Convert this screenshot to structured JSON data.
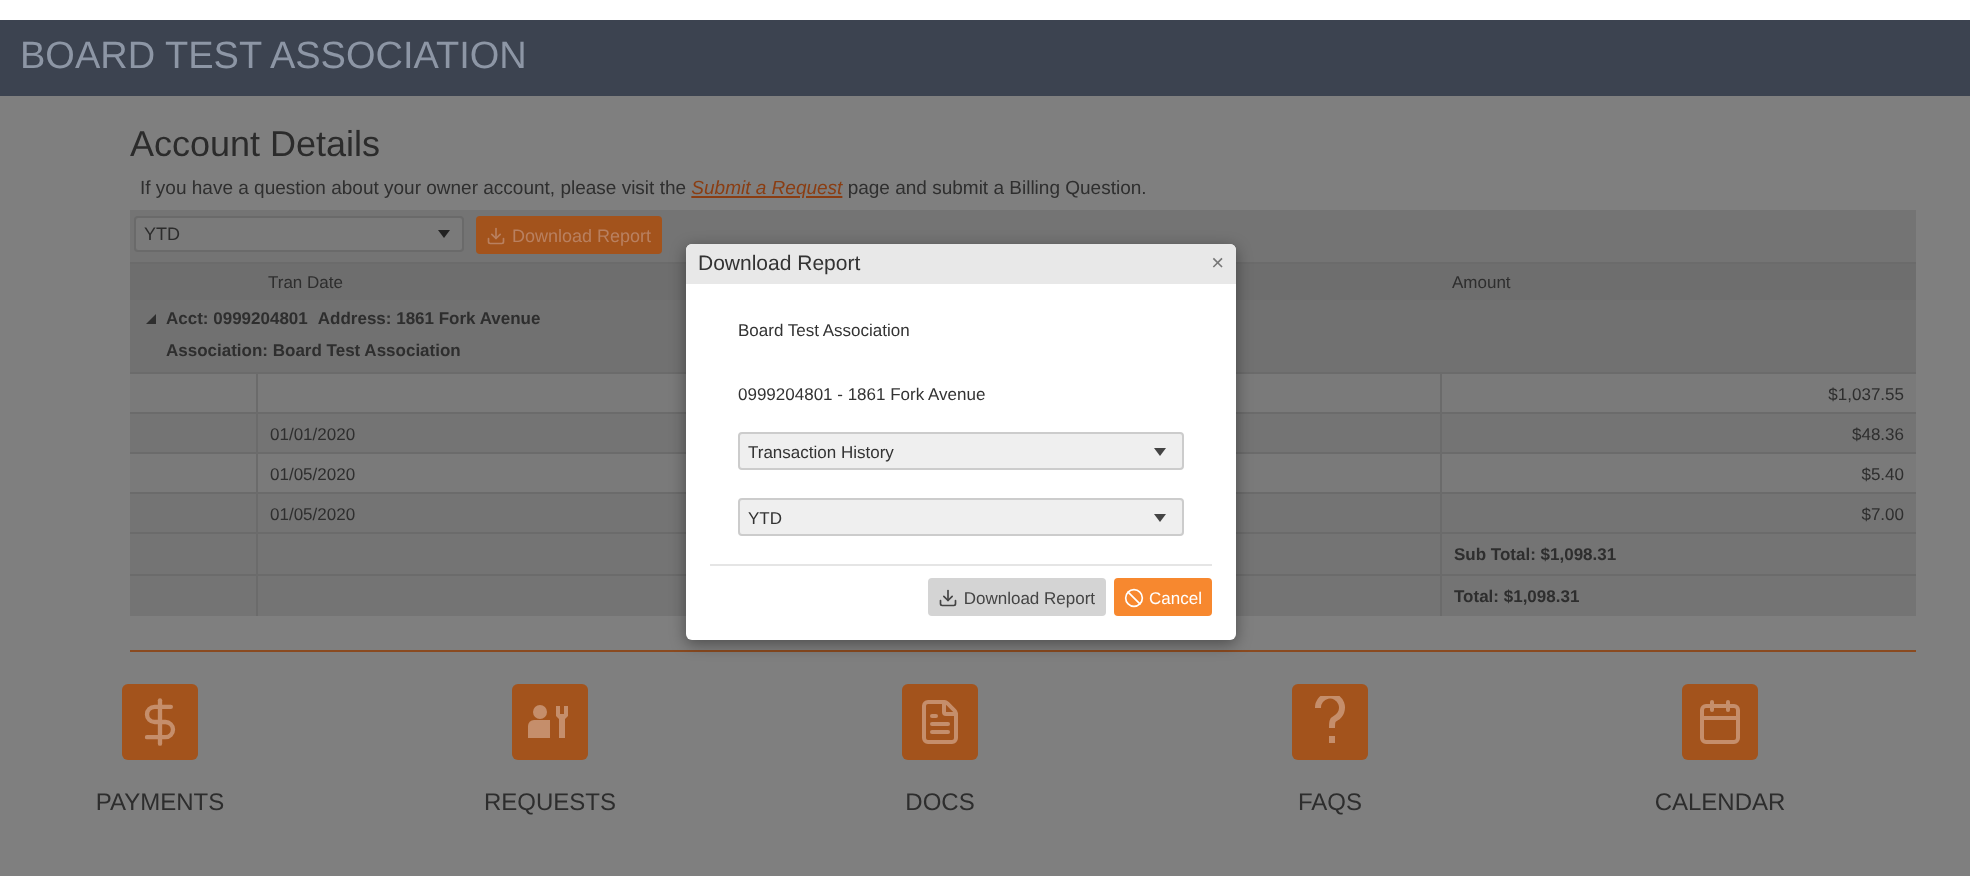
{
  "header": {
    "title": "BOARD TEST ASSOCIATION"
  },
  "page": {
    "title": "Account Details",
    "intro_before": "If you have a question about your owner account, please visit the ",
    "intro_link": "Submit a Request",
    "intro_after": " page and submit a Billing Question."
  },
  "toolbar": {
    "period": "YTD",
    "download_button": "Download Report"
  },
  "table": {
    "columns": [
      "Tran Date",
      "Amount"
    ],
    "group": {
      "expanded": true,
      "account": "Acct: 0999204801",
      "address": "Address: 1861 Fork Avenue",
      "association": "Association: Board Test Association"
    },
    "rows": [
      {
        "date": "",
        "amount": "$1,037.55"
      },
      {
        "date": "01/01/2020",
        "amount": "$48.36"
      },
      {
        "date": "01/05/2020",
        "amount": "$5.40"
      },
      {
        "date": "01/05/2020",
        "amount": "$7.00"
      }
    ],
    "subtotal": "Sub Total: $1,098.31",
    "total": "Total: $1,098.31"
  },
  "nav": [
    {
      "kind": "payments",
      "label": "PAYMENTS"
    },
    {
      "kind": "requests",
      "label": "REQUESTS"
    },
    {
      "kind": "docs",
      "label": "DOCS"
    },
    {
      "kind": "faqs",
      "label": "FAQS"
    },
    {
      "kind": "calendar",
      "label": "CALENDAR"
    }
  ],
  "dialog": {
    "title": "Download Report",
    "close": "×",
    "association": "Board Test Association",
    "account": "0999204801 - 1861 Fork Avenue",
    "report_type": "Transaction History",
    "period": "YTD",
    "download_button": "Download Report",
    "cancel_button": "Cancel"
  }
}
